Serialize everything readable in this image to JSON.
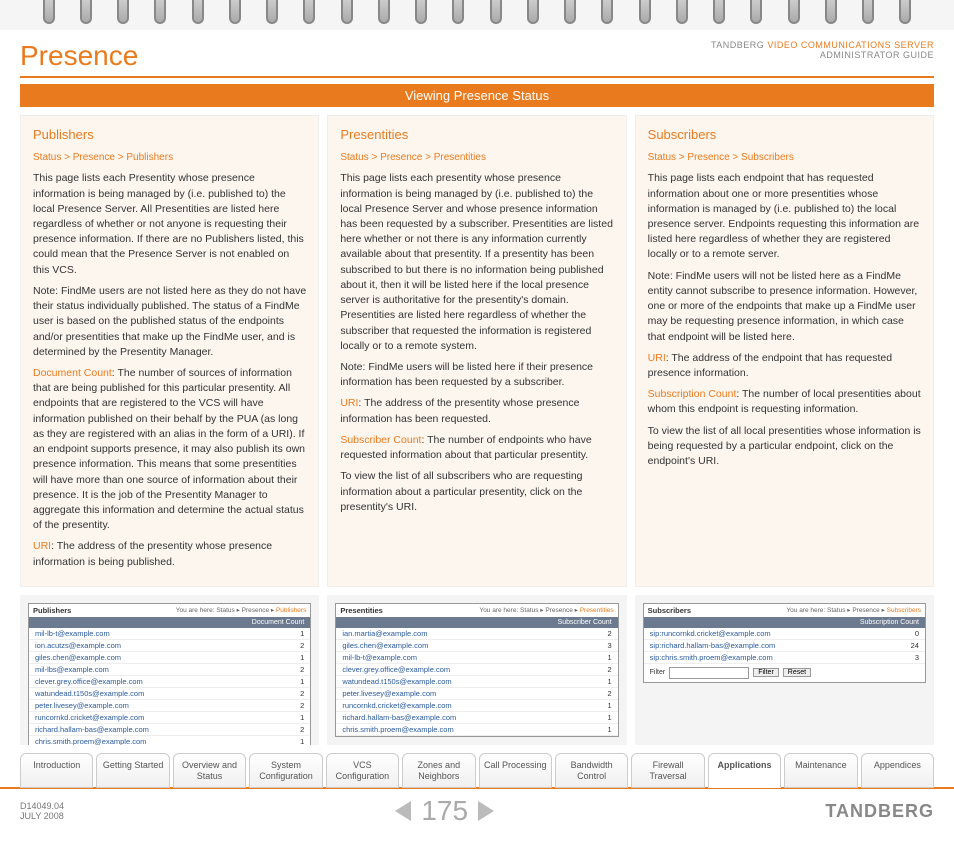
{
  "header": {
    "title": "Presence",
    "brand_line1_a": "TANDBERG ",
    "brand_line1_b": "VIDEO COMMUNICATIONS SERVER",
    "brand_line2": "ADMINISTRATOR GUIDE"
  },
  "banner": "Viewing Presence Status",
  "col1": {
    "heading": "Publishers",
    "crumb": "Status > Presence > Publishers",
    "p1": "This page lists each Presentity whose presence information is being managed by (i.e. published to) the local Presence Server. All Presentities are listed here regardless of whether or not anyone is requesting their presence information. If there are no Publishers listed, this could mean that the Presence Server is not enabled on this VCS.",
    "p2": "Note: FindMe users are not listed here as they do not have their status individually published.  The status of a FindMe user is based on the published status of the endpoints and/or presentities that make up the FindMe user, and is determined by the Presentity Manager.",
    "t1": "Document Count",
    "p3": ": The number of sources of information that are being published for this particular presentity. All endpoints that are registered to the VCS will have information published on their behalf by the PUA (as long as they are registered with an alias in the form of a URI). If an endpoint supports presence, it may also publish its own presence information.  This means that some presentities will have more than one source of information about their presence.  It is the job of the Presentity Manager to aggregate this information and determine the actual status of the presentity.",
    "t2": "URI",
    "p4": ": The address of the presentity whose presence information is being published."
  },
  "col2": {
    "heading": "Presentities",
    "crumb": "Status > Presence > Presentities",
    "p1": "This page lists each presentity whose presence information is being managed by (i.e. published to) the local Presence Server and whose presence information has been requested by a subscriber.  Presentities are listed here whether or not there is any information currently available about that presentity.  If a presentity has been subscribed to but there is no information being published about it, then it will be listed here if the local presence server is authoritative for the presentity's domain. Presentities are listed here regardless of whether the subscriber that requested the information is registered locally or to a remote system.",
    "p2": "Note: FindMe users will be listed here if their presence information has been requested by a subscriber.",
    "t1": "URI",
    "p3": ": The address of the presentity whose presence information has been requested.",
    "t2": "Subscriber Count",
    "p4": ": The number of endpoints who have requested information about that particular presentity.",
    "p5": "To view the list of all subscribers who are requesting information about a particular presentity, click on the presentity's URI."
  },
  "col3": {
    "heading": "Subscribers",
    "crumb": "Status > Presence > Subscribers",
    "p1": "This page lists each endpoint that has requested information about one or more presentities whose information is managed by (i.e. published to) the local presence server.  Endpoints requesting this information are listed here regardless of whether they are registered locally or to a remote server.",
    "p2": "Note: FindMe users will not be listed here as a FindMe entity cannot subscribe to presence information.  However, one or more of the endpoints that make up a FindMe user may be requesting presence information, in which case that endpoint will be listed here.",
    "t1": "URI",
    "p3": ": The address of the endpoint that has requested presence information.",
    "t2": "Subscription Count",
    "p4": ": The number of local presentities about whom this endpoint is requesting information.",
    "p5": "To view the list of all local presentities whose information is being requested by a particular endpoint, click on the endpoint's URI."
  },
  "shot1": {
    "title": "Publishers",
    "path_a": "You are here: Status ▸ Presence ▸ ",
    "path_b": "Publishers",
    "th": "Document Count",
    "rows": [
      {
        "u": "mil-lb-t@example.com",
        "c": "1"
      },
      {
        "u": "ion.acutzs@example.com",
        "c": "2"
      },
      {
        "u": "giles.chen@example.com",
        "c": "1"
      },
      {
        "u": "mil-lbs@example.com",
        "c": "2"
      },
      {
        "u": "clever.grey.office@example.com",
        "c": "1"
      },
      {
        "u": "watundead.t150s@example.com",
        "c": "2"
      },
      {
        "u": "peter.livesey@example.com",
        "c": "2"
      },
      {
        "u": "runcornkd.cricket@example.com",
        "c": "1"
      },
      {
        "u": "richard.hallam-bas@example.com",
        "c": "2"
      },
      {
        "u": "chris.smith.proem@example.com",
        "c": "1"
      }
    ]
  },
  "shot2": {
    "title": "Presentities",
    "path_a": "You are here: Status ▸ Presence ▸ ",
    "path_b": "Presentities",
    "th": "Subscriber Count",
    "rows": [
      {
        "u": "ian.martia@example.com",
        "c": "2"
      },
      {
        "u": "giles.chen@example.com",
        "c": "3"
      },
      {
        "u": "mil-lb-t@example.com",
        "c": "1"
      },
      {
        "u": "clever.grey.office@example.com",
        "c": "2"
      },
      {
        "u": "watundead.t150s@example.com",
        "c": "1"
      },
      {
        "u": "peter.livesey@example.com",
        "c": "2"
      },
      {
        "u": "runcornkd.cricket@example.com",
        "c": "1"
      },
      {
        "u": "richard.hallam-bas@example.com",
        "c": "1"
      },
      {
        "u": "chris.smith.proem@example.com",
        "c": "1"
      }
    ]
  },
  "shot3": {
    "title": "Subscribers",
    "path_a": "You are here: Status ▸ Presence ▸ ",
    "path_b": "Subscribers",
    "th": "Subscription Count",
    "rows": [
      {
        "u": "sip:runcornkd.cricket@example.com",
        "c": "0"
      },
      {
        "u": "sip:richard.hallam-bas@example.com",
        "c": "24"
      },
      {
        "u": "sip:chris.smith.proem@example.com",
        "c": "3"
      }
    ],
    "filter_label": "Filter",
    "filter_btn": "Filter",
    "reset_btn": "Reset"
  },
  "tabs": [
    "Introduction",
    "Getting Started",
    "Overview and Status",
    "System Configuration",
    "VCS Configuration",
    "Zones and Neighbors",
    "Call Processing",
    "Bandwidth Control",
    "Firewall Traversal",
    "Applications",
    "Maintenance",
    "Appendices"
  ],
  "active_tab": 9,
  "footer": {
    "doc1": "D14049.04",
    "doc2": "JULY 2008",
    "page": "175",
    "brand": "TANDBERG"
  }
}
